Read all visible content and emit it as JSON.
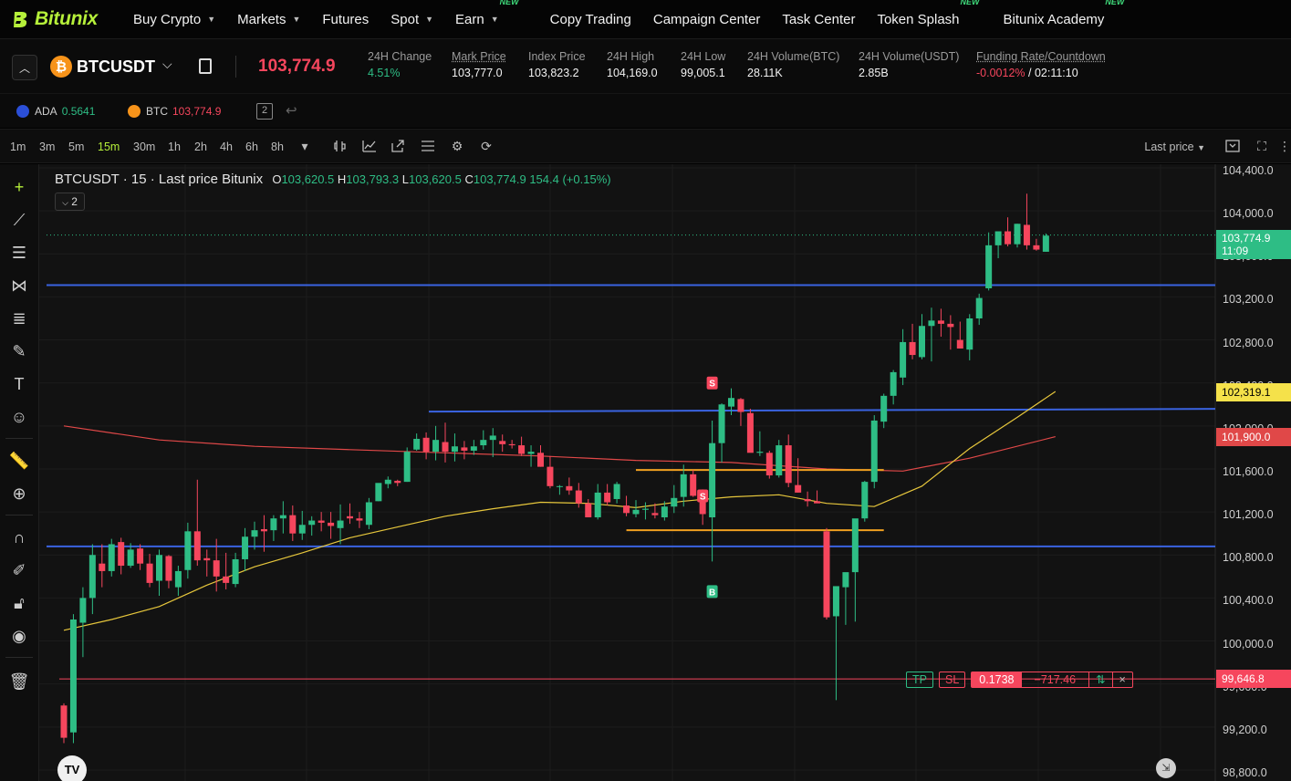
{
  "nav": {
    "logo_text": "Bitunix",
    "items": [
      {
        "label": "Buy Crypto",
        "caret": true,
        "new": false
      },
      {
        "label": "Markets",
        "caret": true,
        "new": false
      },
      {
        "label": "Futures",
        "caret": false,
        "new": false
      },
      {
        "label": "Spot",
        "caret": true,
        "new": false
      },
      {
        "label": "Earn",
        "caret": true,
        "new": true
      },
      {
        "label": "Copy Trading",
        "caret": false,
        "new": false
      },
      {
        "label": "Campaign Center",
        "caret": false,
        "new": false
      },
      {
        "label": "Task Center",
        "caret": false,
        "new": false
      },
      {
        "label": "Token Splash",
        "caret": false,
        "new": true
      },
      {
        "label": "Bitunix Academy",
        "caret": false,
        "new": true
      }
    ],
    "new_badge": "NEW"
  },
  "ticker": {
    "coin_glyph": "₿",
    "symbol": "BTCUSDT",
    "last_price": "103,774.9",
    "stats": [
      {
        "label": "24H Change",
        "value": "4.51%",
        "tone": "green",
        "underline": false
      },
      {
        "label": "Mark Price",
        "value": "103,777.0",
        "tone": "",
        "underline": true
      },
      {
        "label": "Index Price",
        "value": "103,823.2",
        "tone": "",
        "underline": false
      },
      {
        "label": "24H High",
        "value": "104,169.0",
        "tone": "",
        "underline": false
      },
      {
        "label": "24H Low",
        "value": "99,005.1",
        "tone": "",
        "underline": false
      },
      {
        "label": "24H Volume(BTC)",
        "value": "28.11K",
        "tone": "",
        "underline": false
      },
      {
        "label": "24H Volume(USDT)",
        "value": "2.85B",
        "tone": "",
        "underline": false
      }
    ],
    "funding": {
      "label": "Funding Rate/Countdown",
      "rate": "-0.0012%",
      "sep": " / ",
      "countdown": "02:11:10"
    }
  },
  "watchlist": [
    {
      "name": "ADA",
      "price": "0.5641",
      "tone": "green",
      "color": "#2b4fd8"
    },
    {
      "name": "BTC",
      "price": "103,774.9",
      "tone": "red",
      "color": "#f7931a"
    }
  ],
  "toolbar": {
    "timeframes": [
      "1m",
      "3m",
      "5m",
      "15m",
      "30m",
      "1h",
      "2h",
      "4h",
      "6h",
      "8h"
    ],
    "active": "15m",
    "price_source": "Last price"
  },
  "legend": {
    "title": "BTCUSDT · 15 · Last price Bitunix",
    "o_label": "O",
    "o": "103,620.5",
    "h_label": "H",
    "h": "103,793.3",
    "l_label": "L",
    "l": "103,620.5",
    "c_label": "C",
    "c": "103,774.9",
    "change": "154.4 (+0.15%)",
    "indicator_count": "2"
  },
  "axis": {
    "ticks": [
      "104,400.0",
      "104,000.0",
      "103,600.0",
      "103,200.0",
      "102,800.0",
      "102,400.0",
      "102,000.0",
      "101,600.0",
      "101,200.0",
      "100,800.0",
      "100,400.0",
      "100,000.0",
      "99,600.0",
      "99,200.0",
      "98,800.0"
    ],
    "last_price_label": "103,774.9",
    "countdown_label": "11:09",
    "ma_label": "102,319.1",
    "ma2_label": "101,900.0",
    "order_label": "99,646.8"
  },
  "order": {
    "tp": "TP",
    "sl": "SL",
    "qty": "0.1738",
    "pnl": "−717.46",
    "swap": "⇅",
    "close": "×"
  },
  "markers": {
    "sell": "S",
    "buy": "B"
  },
  "tv_logo": "TV",
  "colors": {
    "up": "#2ebd85",
    "down": "#f6465d",
    "accent": "#b6f03a",
    "hline": "#3a63e0",
    "ma_fast": "#e7c73c",
    "ma_slow": "#e04848",
    "box": "#f0a020"
  },
  "chart_data": {
    "type": "candlestick",
    "symbol": "BTCUSDT",
    "interval": "15",
    "y_range": [
      98800,
      104400
    ],
    "candles": [
      [
        99400,
        99420,
        99050,
        99100
      ],
      [
        99150,
        100250,
        99050,
        100200
      ],
      [
        100170,
        100500,
        99850,
        100400
      ],
      [
        100400,
        100900,
        100250,
        100800
      ],
      [
        100720,
        100900,
        100500,
        100650
      ],
      [
        100650,
        100950,
        100600,
        100900
      ],
      [
        100920,
        100960,
        100620,
        100700
      ],
      [
        100700,
        100910,
        100680,
        100850
      ],
      [
        100860,
        100900,
        100660,
        100720
      ],
      [
        100720,
        100810,
        100500,
        100540
      ],
      [
        100560,
        100850,
        100420,
        100800
      ],
      [
        100790,
        100800,
        100490,
        100560
      ],
      [
        100500,
        100700,
        100420,
        100650
      ],
      [
        100660,
        101100,
        100580,
        101020
      ],
      [
        101020,
        101500,
        100700,
        100750
      ],
      [
        100770,
        100850,
        100600,
        100750
      ],
      [
        100750,
        100950,
        100460,
        100600
      ],
      [
        100600,
        100820,
        100480,
        100540
      ],
      [
        100530,
        100820,
        100500,
        100760
      ],
      [
        100760,
        101050,
        100650,
        100970
      ],
      [
        100970,
        101110,
        100850,
        101030
      ],
      [
        101040,
        101170,
        100830,
        101020
      ],
      [
        101030,
        101170,
        100930,
        101140
      ],
      [
        101140,
        101300,
        101000,
        101170
      ],
      [
        101170,
        101260,
        100930,
        101000
      ],
      [
        101000,
        101210,
        100940,
        101080
      ],
      [
        101080,
        101160,
        100980,
        101120
      ],
      [
        101120,
        101200,
        101020,
        101100
      ],
      [
        101100,
        101200,
        100950,
        101070
      ],
      [
        101050,
        101270,
        100900,
        101120
      ],
      [
        101160,
        101280,
        101090,
        101140
      ],
      [
        101140,
        101200,
        101050,
        101120
      ],
      [
        101080,
        101330,
        101040,
        101290
      ],
      [
        101300,
        101460,
        101300,
        101470
      ],
      [
        101460,
        101530,
        101420,
        101500
      ],
      [
        101490,
        101500,
        101440,
        101470
      ],
      [
        101480,
        101800,
        101480,
        101760
      ],
      [
        101780,
        101930,
        101770,
        101880
      ],
      [
        101890,
        101940,
        101690,
        101760
      ],
      [
        101760,
        102000,
        101680,
        101870
      ],
      [
        101850,
        102030,
        101660,
        101760
      ],
      [
        101760,
        101930,
        101670,
        101810
      ],
      [
        101800,
        101860,
        101690,
        101770
      ],
      [
        101770,
        101870,
        101730,
        101810
      ],
      [
        101820,
        101960,
        101780,
        101870
      ],
      [
        101870,
        101980,
        101710,
        101910
      ],
      [
        101860,
        101920,
        101760,
        101830
      ],
      [
        101830,
        101870,
        101790,
        101820
      ],
      [
        101820,
        101900,
        101720,
        101740
      ],
      [
        101740,
        101820,
        101620,
        101760
      ],
      [
        101750,
        101820,
        101620,
        101620
      ],
      [
        101620,
        101720,
        101420,
        101440
      ],
      [
        101440,
        101450,
        101360,
        101440
      ],
      [
        101440,
        101520,
        101360,
        101400
      ],
      [
        101400,
        101470,
        101240,
        101280
      ],
      [
        101280,
        101320,
        101150,
        101150
      ],
      [
        101150,
        101460,
        101130,
        101380
      ],
      [
        101380,
        101460,
        101260,
        101290
      ],
      [
        101320,
        101480,
        101280,
        101460
      ],
      [
        101260,
        101350,
        101160,
        101190
      ],
      [
        101180,
        101310,
        101150,
        101220
      ],
      [
        101220,
        101290,
        101130,
        101230
      ],
      [
        101190,
        101280,
        101140,
        101170
      ],
      [
        101150,
        101300,
        101120,
        101250
      ],
      [
        101250,
        101450,
        101190,
        101330
      ],
      [
        101340,
        101640,
        101250,
        101550
      ],
      [
        101550,
        101590,
        101340,
        101350
      ],
      [
        101330,
        101410,
        101080,
        101180
      ],
      [
        101150,
        102050,
        100740,
        101840
      ],
      [
        101840,
        102210,
        101660,
        102200
      ],
      [
        102180,
        102350,
        102100,
        102260
      ],
      [
        102250,
        102260,
        102000,
        102130
      ],
      [
        102120,
        102160,
        101780,
        101750
      ],
      [
        101750,
        101950,
        101720,
        101760
      ],
      [
        101750,
        101770,
        101510,
        101540
      ],
      [
        101540,
        101870,
        101520,
        101820
      ],
      [
        101820,
        101920,
        101430,
        101470
      ],
      [
        101450,
        101700,
        101380,
        101380
      ],
      [
        101320,
        101390,
        101250,
        101300
      ],
      [
        101300,
        101400,
        101290,
        101280
      ],
      [
        101020,
        101050,
        100200,
        100220
      ],
      [
        100230,
        100500,
        99450,
        100510
      ],
      [
        100500,
        100630,
        100150,
        100640
      ],
      [
        100640,
        101050,
        100180,
        101140
      ],
      [
        101140,
        101490,
        101110,
        101480
      ],
      [
        101480,
        102100,
        101420,
        102050
      ],
      [
        102040,
        102300,
        101980,
        102280
      ],
      [
        102280,
        102520,
        102200,
        102500
      ],
      [
        102450,
        102900,
        102380,
        102780
      ],
      [
        102780,
        102950,
        102620,
        102660
      ],
      [
        102640,
        103040,
        102620,
        102930
      ],
      [
        102930,
        103100,
        102600,
        102980
      ],
      [
        102980,
        103090,
        102830,
        102950
      ],
      [
        102950,
        103030,
        102710,
        102920
      ],
      [
        102800,
        102970,
        102740,
        102720
      ],
      [
        102710,
        103040,
        102610,
        103000
      ],
      [
        103000,
        103230,
        102940,
        103190
      ],
      [
        103280,
        103800,
        103260,
        103680
      ],
      [
        103680,
        103800,
        103560,
        103810
      ],
      [
        103810,
        103940,
        103670,
        103690
      ],
      [
        103690,
        103880,
        103660,
        103880
      ],
      [
        103870,
        104160,
        103640,
        103680
      ],
      [
        103680,
        103740,
        103630,
        103640
      ],
      [
        103620,
        103790,
        103620,
        103770
      ]
    ],
    "ma_fast": [
      [
        0,
        100100
      ],
      [
        5,
        100200
      ],
      [
        10,
        100320
      ],
      [
        15,
        100520
      ],
      [
        20,
        100690
      ],
      [
        25,
        100820
      ],
      [
        30,
        100960
      ],
      [
        35,
        101060
      ],
      [
        40,
        101160
      ],
      [
        45,
        101230
      ],
      [
        50,
        101290
      ],
      [
        55,
        101280
      ],
      [
        60,
        101240
      ],
      [
        65,
        101300
      ],
      [
        70,
        101340
      ],
      [
        75,
        101360
      ],
      [
        80,
        101280
      ],
      [
        85,
        101250
      ],
      [
        90,
        101440
      ],
      [
        95,
        101790
      ],
      [
        100,
        102080
      ],
      [
        104,
        102320
      ]
    ],
    "ma_slow": [
      [
        0,
        102000
      ],
      [
        10,
        101870
      ],
      [
        20,
        101810
      ],
      [
        30,
        101780
      ],
      [
        40,
        101750
      ],
      [
        50,
        101720
      ],
      [
        60,
        101680
      ],
      [
        70,
        101660
      ],
      [
        80,
        101600
      ],
      [
        88,
        101580
      ],
      [
        95,
        101700
      ],
      [
        104,
        101900
      ]
    ],
    "horizontal_lines": [
      103310,
      100880,
      102150
    ],
    "ranges": [
      {
        "from": 60,
        "to": 80,
        "low": 101030,
        "high": 101590
      }
    ],
    "order_price": 99646.8,
    "last_price": 103774.9
  }
}
